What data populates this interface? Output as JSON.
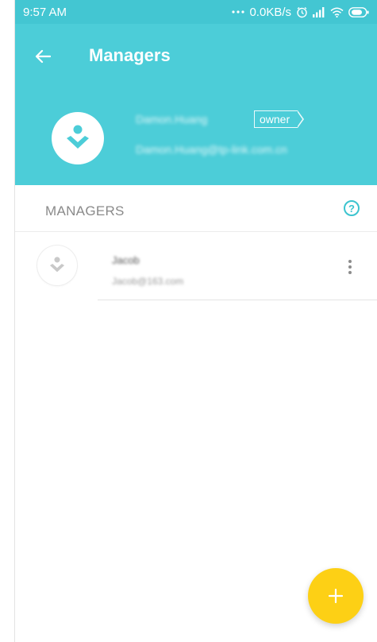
{
  "status_bar": {
    "time": "9:57 AM",
    "network_speed": "0.0KB/s",
    "icons": [
      "more-dots-icon",
      "alarm-icon",
      "signal-icon",
      "wifi-icon",
      "battery-icon"
    ]
  },
  "header": {
    "title": "Managers",
    "back_icon": "arrow-left-icon",
    "background_color": "#4ccdd8",
    "owner": {
      "name": "Damon.Huang",
      "badge": "owner",
      "email": "Damon.Huang@tp-link.com.cn"
    }
  },
  "section": {
    "title": "MANAGERS",
    "help_icon": "?"
  },
  "managers": [
    {
      "name": "Jacob",
      "email": "Jacob@163.com"
    }
  ],
  "fab": {
    "icon": "+",
    "color": "#fdd015"
  }
}
